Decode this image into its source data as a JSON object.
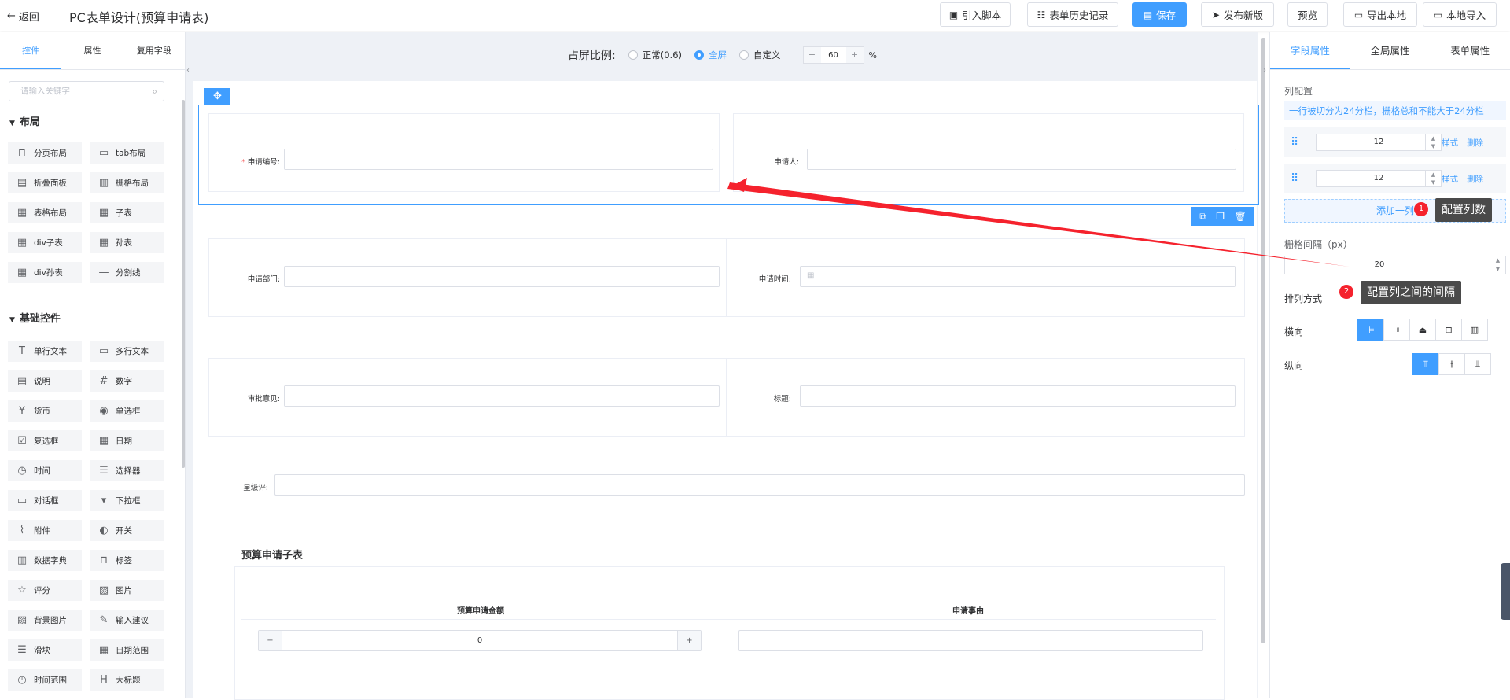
{
  "header": {
    "back_label": "返回",
    "title": "PC表单设计(预算申请表)",
    "buttons": {
      "import_script": "引入脚本",
      "history": "表单历史记录",
      "save": "保存",
      "publish": "发布新版",
      "preview": "预览",
      "export_local": "导出本地",
      "import_local": "本地导入"
    }
  },
  "left_panel": {
    "tabs": [
      "控件",
      "属性",
      "复用字段"
    ],
    "search_placeholder": "请输入关键字",
    "sections": {
      "layout": {
        "title": "布局",
        "items": [
          "分页布局",
          "tab布局",
          "折叠面板",
          "栅格布局",
          "表格布局",
          "子表",
          "div子表",
          "孙表",
          "div孙表",
          "分割线"
        ]
      },
      "basic": {
        "title": "基础控件",
        "items": [
          "单行文本",
          "多行文本",
          "说明",
          "数字",
          "货币",
          "单选框",
          "复选框",
          "日期",
          "时间",
          "选择器",
          "对话框",
          "下拉框",
          "附件",
          "开关",
          "数据字典",
          "标签",
          "评分",
          "图片",
          "背景图片",
          "输入建议",
          "滑块",
          "日期范围",
          "时间范围",
          "大标题"
        ]
      }
    }
  },
  "canvas": {
    "ratio_label": "占屏比例:",
    "options": [
      "正常(0.6)",
      "全屏",
      "自定义"
    ],
    "selected_option": "全屏",
    "custom_value": "60",
    "percent": "%",
    "fields": {
      "apply_no": "申请编号:",
      "applicant": "申请人:",
      "department": "申请部门:",
      "apply_time": "申请时间:",
      "approval_opinion": "审批意见:",
      "title": "标题:",
      "stars": "星级评:"
    },
    "subtable": {
      "title": "预算申请子表",
      "headers": [
        "预算申请金额",
        "申请事由"
      ],
      "amount_value": "0",
      "minus": "−",
      "plus": "+"
    }
  },
  "right_panel": {
    "tabs": [
      "字段属性",
      "全局属性",
      "表单属性"
    ],
    "col_config_label": "列配置",
    "hint": "一行被切分为24分栏，栅格总和不能大于24分栏",
    "columns": [
      {
        "value": "12",
        "style": "样式",
        "delete": "删除"
      },
      {
        "value": "12",
        "style": "样式",
        "delete": "删除"
      }
    ],
    "add_column": "添加一列",
    "gutter_label": "栅格间隔（px）",
    "gutter_value": "20",
    "arrange_label": "排列方式",
    "horizontal_label": "横向",
    "vertical_label": "纵向",
    "horizontal_selected_index": 0,
    "vertical_selected_index": 0
  },
  "annotations": [
    {
      "num": "1",
      "text": "配置列数"
    },
    {
      "num": "2",
      "text": "配置列之间的间隔"
    }
  ],
  "colors": {
    "accent": "#409eff",
    "annotation_red": "#f5222d",
    "tooltip_bg": "#4a4a4a"
  }
}
